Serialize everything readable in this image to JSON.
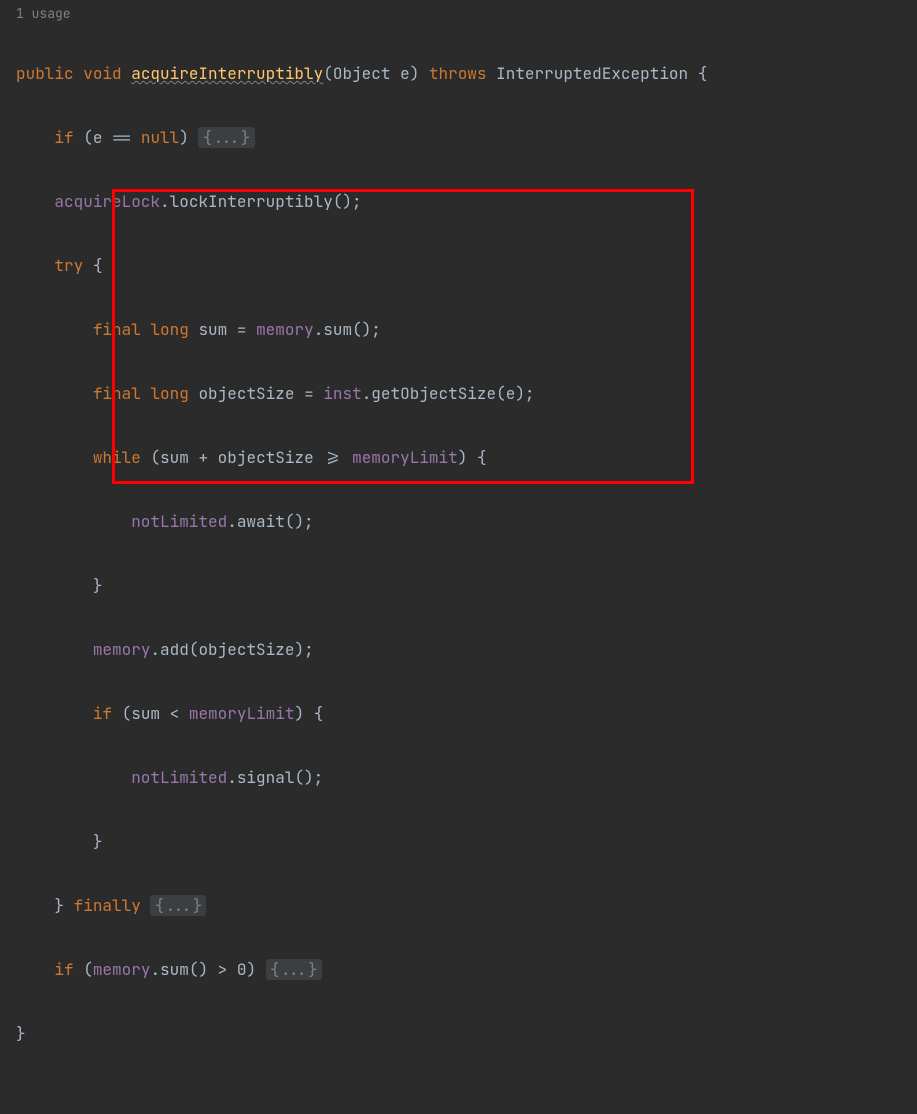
{
  "editor": {
    "usage_hint": "1 usage",
    "fold_placeholder": "{...}",
    "tokens": {
      "kw_public": "public",
      "kw_void": "void",
      "kw_throws": "throws",
      "kw_if": "if",
      "kw_try": "try",
      "kw_final": "final",
      "kw_long": "long",
      "kw_while": "while",
      "kw_finally": "finally",
      "kw_null": "null",
      "method_name": "acquireInterruptibly",
      "param_type": "Object",
      "param_name": "e",
      "exception_type": "InterruptedException",
      "cond_e_null": "e == null",
      "field_acquireLock": "acquireLock",
      "call_lockInterruptibly": "lockInterruptibly",
      "var_sum": "sum",
      "field_memory": "memory",
      "call_sum": "sum",
      "var_objectSize": "objectSize",
      "field_inst": "inst",
      "call_getObjectSize": "getObjectSize",
      "arg_e": "e",
      "field_memoryLimit": "memoryLimit",
      "op_plus": " + ",
      "op_ge": " >= ",
      "op_lt": " < ",
      "op_gt": " > ",
      "op_assign": " = ",
      "field_notLimited": "notLimited",
      "call_await": "await",
      "call_add": "add",
      "call_signal": "signal",
      "lit_zero": "0"
    }
  }
}
